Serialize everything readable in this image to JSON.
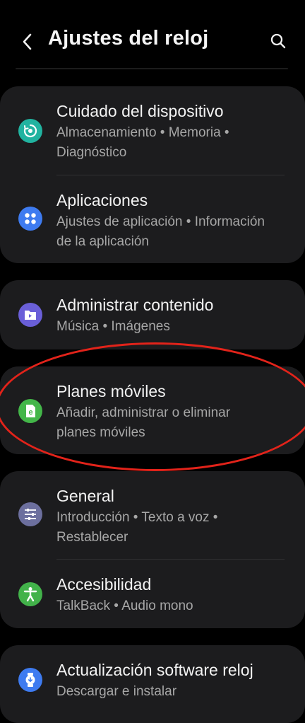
{
  "header": {
    "title": "Ajustes del reloj",
    "back_icon": "chevron-left-icon",
    "search_icon": "search-icon"
  },
  "items": [
    {
      "title": "Cuidado del dispositivo",
      "subtitle": "Almacenamiento • Memoria • Diagnóstico",
      "icon": "device-care-icon",
      "icon_color": "#21b3a0"
    },
    {
      "title": "Aplicaciones",
      "subtitle": "Ajustes de aplicación • Información de la aplicación",
      "icon": "apps-icon",
      "icon_color": "#3e7bf0"
    },
    {
      "title": "Administrar contenido",
      "subtitle": "Música • Imágenes",
      "icon": "content-folder-icon",
      "icon_color": "#6a5fd8"
    },
    {
      "title": "Planes móviles",
      "subtitle": "Añadir, administrar o eliminar planes móviles",
      "icon": "esim-icon",
      "icon_color": "#43b649"
    },
    {
      "title": "General",
      "subtitle": "Introducción • Texto a voz • Restablecer",
      "icon": "sliders-icon",
      "icon_color": "#6c6f9e"
    },
    {
      "title": "Accesibilidad",
      "subtitle": "TalkBack • Audio mono",
      "icon": "accessibility-icon",
      "icon_color": "#42b24a"
    },
    {
      "title": "Actualización software reloj",
      "subtitle": "Descargar e instalar",
      "icon": "watch-update-icon",
      "icon_color": "#3e7bf0"
    }
  ],
  "annotation": {
    "highlight_color": "#e2231a"
  }
}
